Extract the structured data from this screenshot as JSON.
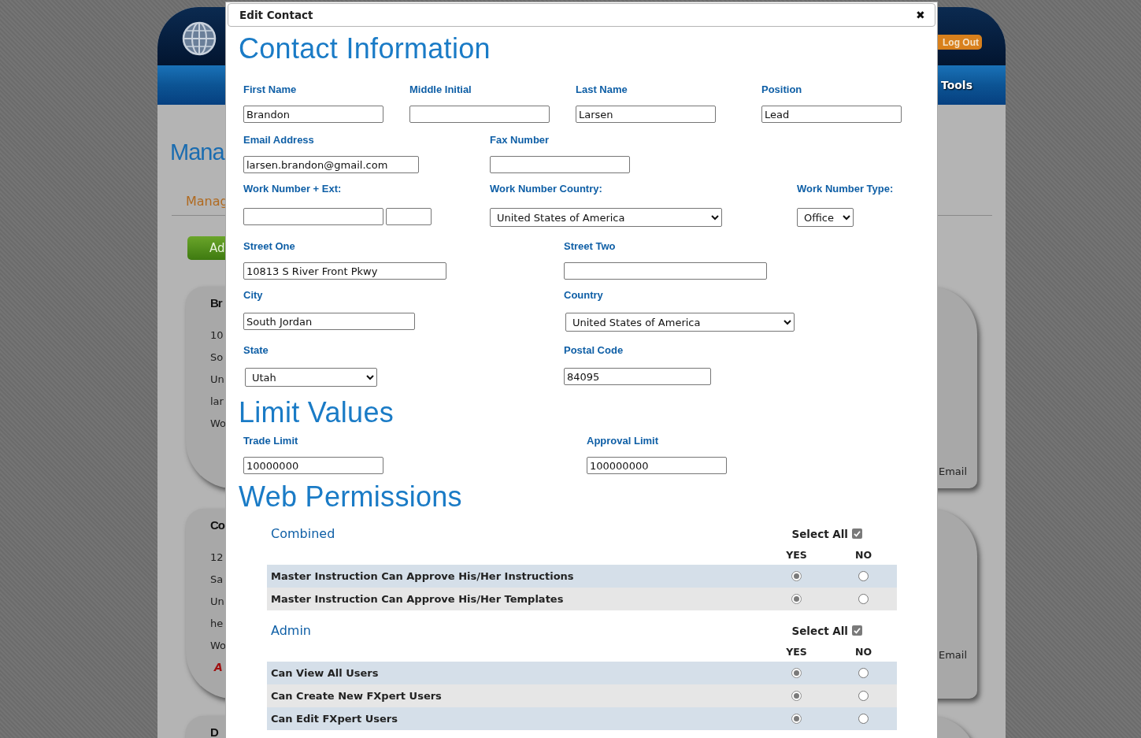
{
  "background_page": {
    "header": {
      "logout_button": "Log Out"
    },
    "nav": {
      "item": "Tools"
    },
    "heading": "Mana",
    "tab": "Manag",
    "add_button": "Ad",
    "cards": [
      {
        "title": "Br",
        "lines": [
          "10",
          "So",
          "Un",
          "lar",
          "Wo"
        ],
        "side_text": "Email"
      },
      {
        "title": "Co",
        "lines": [
          "12",
          "Sa",
          "Un",
          "he",
          "Wo"
        ],
        "side_text": "Email",
        "link": "A"
      },
      {
        "title": "D"
      }
    ]
  },
  "dialog": {
    "title": "Edit Contact",
    "close": "✖",
    "sections": [
      {
        "heading": "Contact Information",
        "rows": [
          {
            "fields": [
              {
                "label": "First Name",
                "inputs": [
                  {
                    "kind": "text",
                    "value": "Brandon"
                  }
                ]
              },
              {
                "label": "Middle Initial",
                "inputs": [
                  {
                    "kind": "text"
                  }
                ]
              },
              {
                "label": "Last Name",
                "inputs": [
                  {
                    "kind": "text",
                    "value": "Larsen"
                  }
                ]
              },
              {
                "label": "Position",
                "inputs": [
                  {
                    "kind": "text",
                    "value": "Lead"
                  }
                ]
              }
            ]
          },
          {
            "fields": [
              {
                "label": "Email Address",
                "inputs": [
                  {
                    "kind": "text",
                    "value": "larsen.brandon@gmail.com"
                  }
                ]
              },
              {
                "label": "Fax Number",
                "inputs": [
                  {
                    "kind": "text"
                  }
                ]
              }
            ]
          },
          {
            "fields": [
              {
                "label": "Work Number + Ext:",
                "inputs": [
                  {
                    "kind": "text"
                  },
                  {
                    "kind": "text"
                  }
                ]
              },
              {
                "label": "Work Number Country:",
                "inputs": [
                  {
                    "kind": "select",
                    "value": "United States of America"
                  }
                ]
              },
              {
                "label": "Work Number Type:",
                "inputs": [
                  {
                    "kind": "select",
                    "value": "Office"
                  }
                ]
              }
            ]
          },
          {
            "fields": [
              {
                "label": "Street One",
                "inputs": [
                  {
                    "kind": "text",
                    "value": "10813 S River Front Pkwy"
                  }
                ]
              },
              {
                "label": "Street Two",
                "inputs": [
                  {
                    "kind": "text"
                  }
                ]
              }
            ]
          },
          {
            "fields": [
              {
                "label": "City",
                "inputs": [
                  {
                    "kind": "text",
                    "value": "South Jordan"
                  }
                ]
              },
              {
                "label": "Country",
                "inputs": [
                  {
                    "kind": "select",
                    "value": "United States of America"
                  }
                ]
              }
            ]
          },
          {
            "fields": [
              {
                "label": "State",
                "inputs": [
                  {
                    "kind": "select",
                    "value": "Utah"
                  }
                ]
              },
              {
                "label": "Postal Code",
                "inputs": [
                  {
                    "kind": "text",
                    "value": "84095"
                  }
                ]
              }
            ]
          }
        ]
      },
      {
        "heading": "Limit Values",
        "rows": [
          {
            "fields": [
              {
                "label": "Trade Limit",
                "inputs": [
                  {
                    "kind": "text",
                    "value": "10000000"
                  }
                ]
              },
              {
                "label": "Approval Limit",
                "inputs": [
                  {
                    "kind": "text",
                    "value": "100000000"
                  }
                ]
              }
            ]
          }
        ]
      }
    ],
    "permissions": {
      "heading": "Web Permissions",
      "groups": [
        {
          "name": "Combined",
          "select_all": {
            "label": "Select All",
            "checked": true
          },
          "yes_label": "YES",
          "no_label": "NO",
          "items": [
            {
              "label": "Master Instruction Can Approve His/Her Instructions",
              "choices": [
                {
                  "selected": true
                },
                {
                  "selected": false
                }
              ]
            },
            {
              "label": "Master Instruction Can Approve His/Her Templates",
              "choices": [
                {
                  "selected": true
                },
                {
                  "selected": false
                }
              ]
            }
          ]
        },
        {
          "name": "Admin",
          "select_all": {
            "label": "Select All",
            "checked": true
          },
          "yes_label": "YES",
          "no_label": "NO",
          "items": [
            {
              "label": "Can View All Users",
              "choices": [
                {
                  "selected": true
                },
                {
                  "selected": false
                }
              ]
            },
            {
              "label": "Can Create New FXpert Users",
              "choices": [
                {
                  "selected": true
                },
                {
                  "selected": false
                }
              ]
            },
            {
              "label": "Can Edit FXpert Users",
              "choices": [
                {
                  "selected": true
                },
                {
                  "selected": false
                }
              ]
            }
          ]
        }
      ]
    }
  }
}
